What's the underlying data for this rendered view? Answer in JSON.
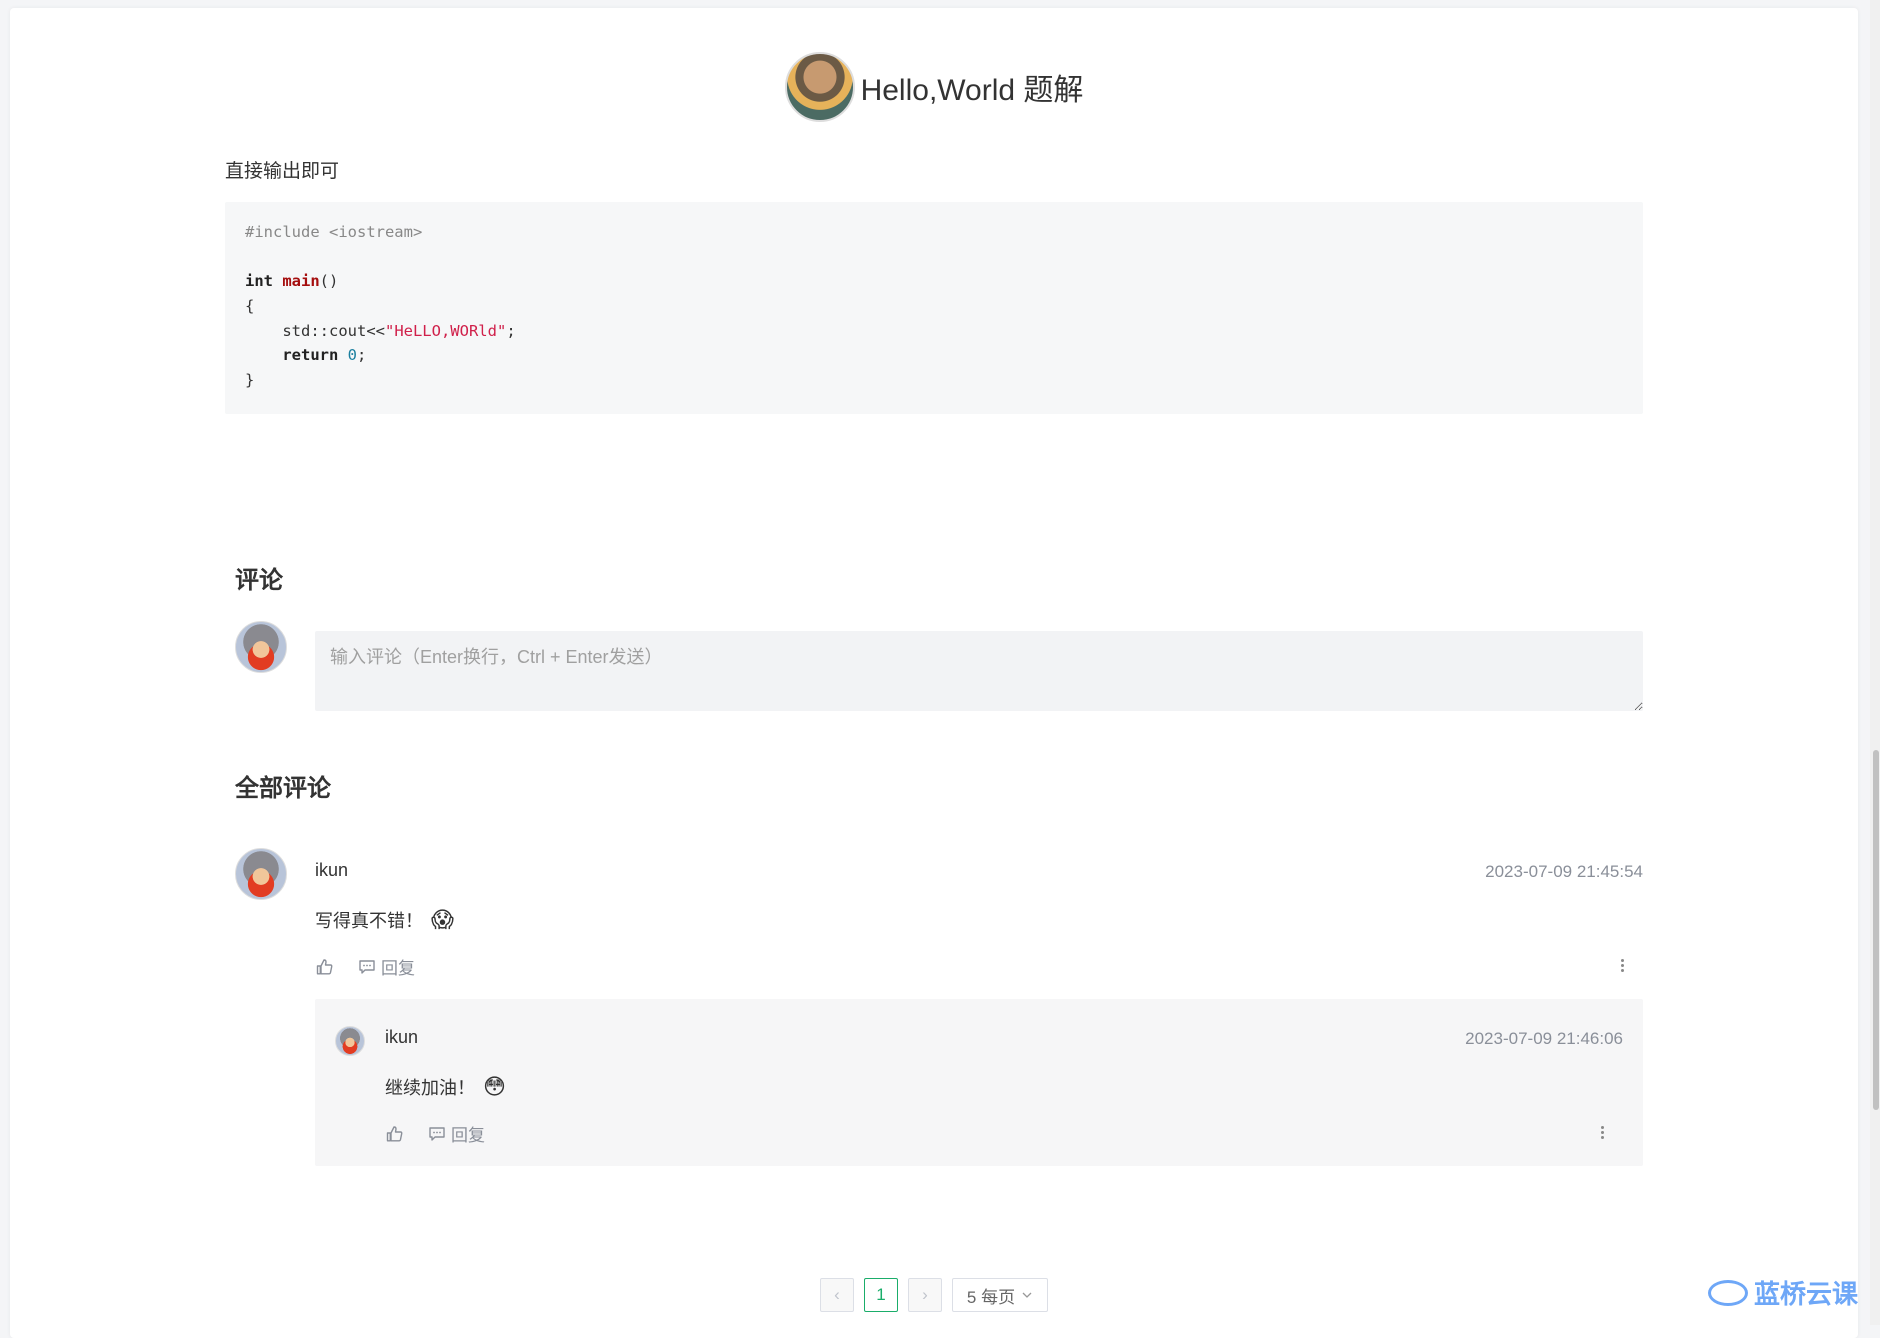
{
  "article": {
    "title": "Hello,World 题解",
    "intro": "直接输出即可",
    "code": {
      "line1": "#include <iostream>",
      "line3_kw": "int",
      "line3_fn": "main",
      "line3_rest": "()",
      "line4": "{",
      "line5_a": "    std::cout<<",
      "line5_str": "\"HeLLO,WORld\"",
      "line5_b": ";",
      "line6_kw": "    return",
      "line6_num": "0",
      "line6_b": ";",
      "line7": "}"
    }
  },
  "comments_section": {
    "heading": "评论",
    "input_placeholder": "输入评论（Enter换行，Ctrl + Enter发送）"
  },
  "all_comments": {
    "heading": "全部评论",
    "items": [
      {
        "user": "ikun",
        "time": "2023-07-09 21:45:54",
        "text": "写得真不错！",
        "emoji": "😱",
        "reply_label": "回复",
        "replies": [
          {
            "user": "ikun",
            "time": "2023-07-09 21:46:06",
            "text": "继续加油！",
            "emoji": "😳",
            "reply_label": "回复"
          }
        ]
      }
    ]
  },
  "pagination": {
    "prev": "‹",
    "current": "1",
    "next": "›",
    "page_size": "5 每页"
  },
  "brand": {
    "logo_text": "蓝桥云课",
    "accent_color": "#1aad6a"
  }
}
